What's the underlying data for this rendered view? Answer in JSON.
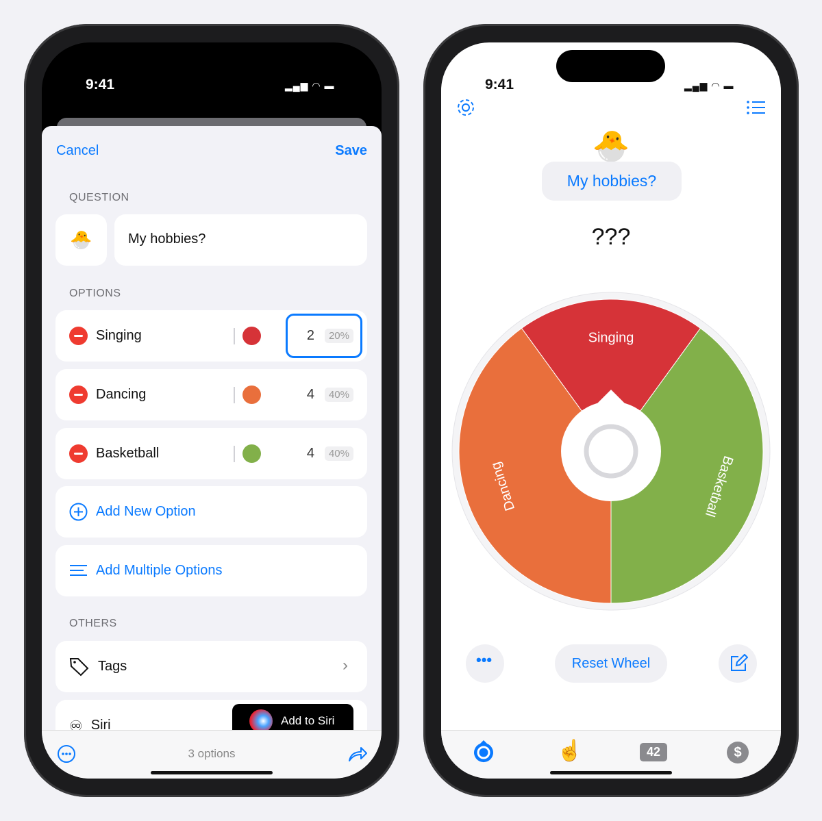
{
  "status": {
    "time": "9:41"
  },
  "editor": {
    "cancel": "Cancel",
    "save": "Save",
    "question_header": "QUESTION",
    "question_emoji": "🐣",
    "question": "My hobbies?",
    "options_header": "OPTIONS",
    "options": [
      {
        "label": "Singing",
        "color": "#d63338",
        "count": "2",
        "percent": "20%",
        "selected": true
      },
      {
        "label": "Dancing",
        "color": "#e96f3c",
        "count": "4",
        "percent": "40%"
      },
      {
        "label": "Basketball",
        "color": "#82b04a",
        "count": "4",
        "percent": "40%"
      }
    ],
    "add_new": "Add New Option",
    "add_multiple": "Add Multiple Options",
    "others_header": "OTHERS",
    "tags": "Tags",
    "siri": "Siri",
    "add_to_siri": "Add to Siri",
    "footer_count": "3 options"
  },
  "wheel_screen": {
    "emoji": "🐣",
    "question": "My hobbies?",
    "result": "???",
    "reset": "Reset Wheel",
    "tab_badge": "42",
    "segments": [
      {
        "label": "Singing",
        "color": "#d63338",
        "weight": 2
      },
      {
        "label": "Basketball",
        "color": "#82b04a",
        "weight": 4
      },
      {
        "label": "Dancing",
        "color": "#e96f3c",
        "weight": 4
      }
    ],
    "accent": "#0a7aff"
  }
}
